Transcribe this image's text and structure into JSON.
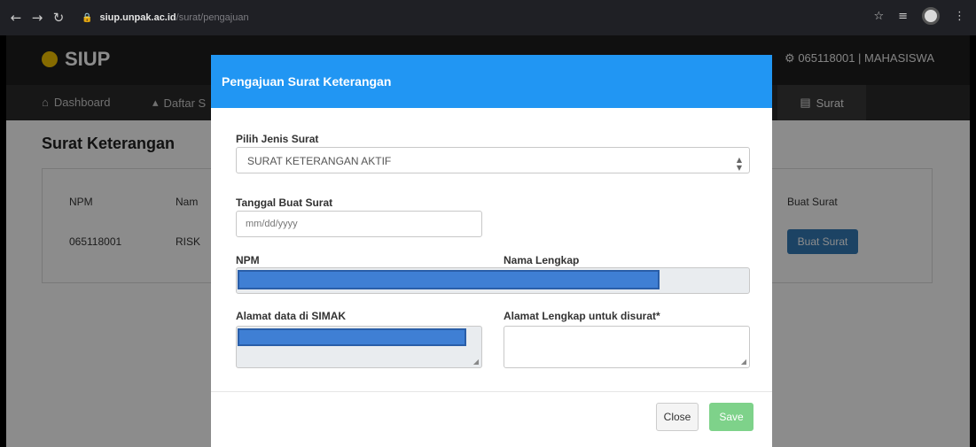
{
  "browser": {
    "url_host": "siup.unpak.ac.id",
    "url_path": "/surat/pengajuan",
    "back_icon": "arrow-left-icon",
    "forward_icon": "arrow-right-icon",
    "reload_icon": "reload-icon"
  },
  "app": {
    "brand": "SIUP",
    "user_label": "⚙ 065118001 | MAHASISWA",
    "menu": {
      "dashboard": "Dashboard",
      "daftar": "Daftar S",
      "surat": "Surat"
    },
    "content_title": "Surat Keterangan",
    "table": {
      "headers": [
        "NPM",
        "Nam",
        "Buat Surat"
      ],
      "row": {
        "npm": "065118001",
        "nama": "RISK",
        "action": "Buat Surat"
      }
    }
  },
  "modal": {
    "title": "Pengajuan Surat Keterangan",
    "jenis_label": "Pilih Jenis Surat",
    "jenis_value": "SURAT KETERANGAN AKTIF",
    "tanggal_label": "Tanggal Buat Surat",
    "tanggal_placeholder": "mm/dd/yyyy",
    "npm_label": "NPM",
    "nama_label": "Nama Lengkap",
    "alamat_simak_label": "Alamat data di SIMAK",
    "alamat_lengkap_label": "Alamat Lengkap untuk disurat*",
    "close_label": "Close",
    "save_label": "Save"
  },
  "colors": {
    "header_blue": "#2196f3",
    "save_green": "#7ed28a",
    "primary_button": "#337ab7",
    "redaction": "#3f7fd4"
  }
}
